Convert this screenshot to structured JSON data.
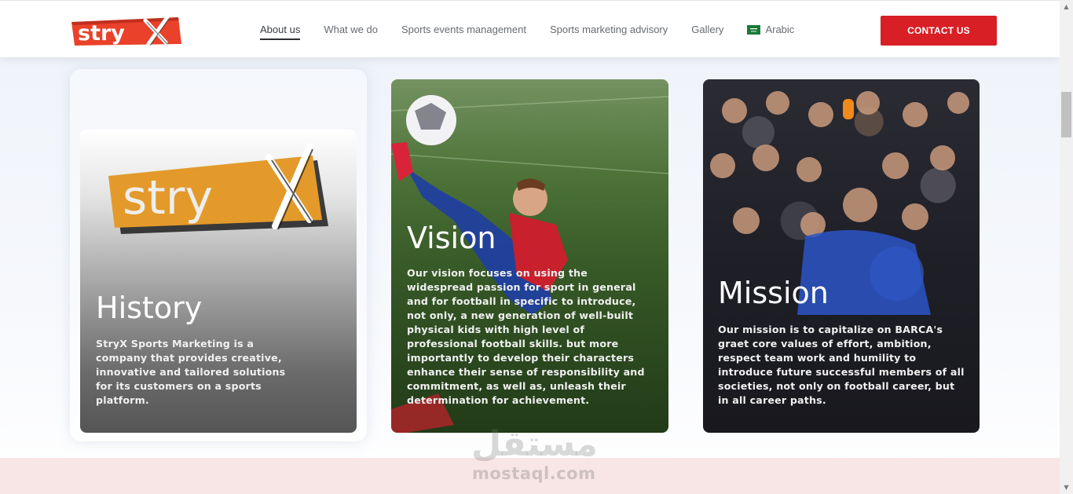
{
  "brand": {
    "logo_text": "stryX",
    "logo_color": "#e9412a"
  },
  "nav": {
    "items": [
      {
        "label": "About us",
        "active": true
      },
      {
        "label": "What we do",
        "active": false
      },
      {
        "label": "Sports events management",
        "active": false
      },
      {
        "label": "Sports marketing advisory",
        "active": false
      },
      {
        "label": "Gallery",
        "active": false
      }
    ],
    "language": {
      "label": "Arabic",
      "icon": "saudi-flag-icon"
    }
  },
  "contact_button": {
    "label": "CONTACT US",
    "color": "#d71f25"
  },
  "cards": {
    "history": {
      "title": "History",
      "text": "StryX Sports Marketing is a company that provides creative, innovative and tailored solutions for its customers on a sports platform."
    },
    "vision": {
      "title": "Vision",
      "text": "Our vision focuses on using the widespread passion for sport in general and for football in specific to introduce, not only, a new generation of well-built physical kids with high level of professional football skills. but more importantly to develop their characters enhance their sense of responsibility and commitment, as well as, unleash their determination for achievement."
    },
    "mission": {
      "title": "Mission",
      "text": "Our mission is to capitalize on BARCA's graet core values of effort, ambition, respect team work and humility to introduce future successful members of all societies, not only on football career, but in all career paths."
    }
  },
  "watermark": {
    "arabic": "مستقل",
    "latin": "mostaql.com"
  }
}
